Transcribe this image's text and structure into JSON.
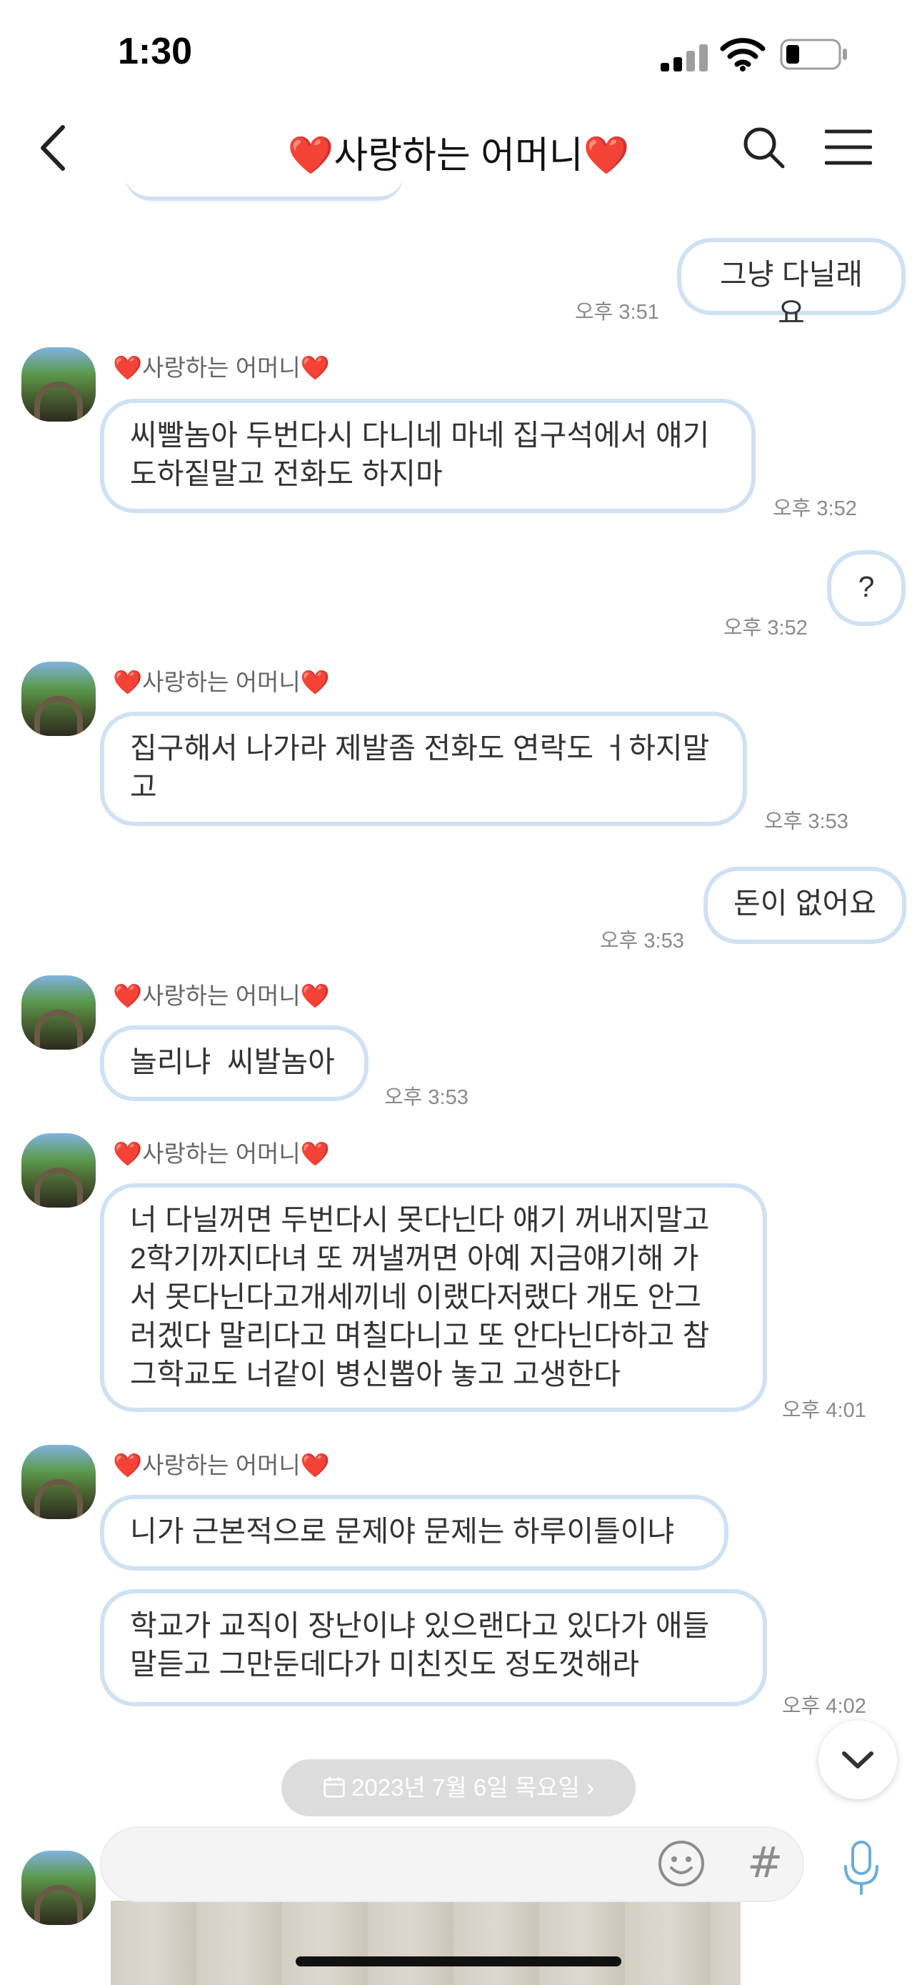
{
  "status": {
    "time": "1:30"
  },
  "header": {
    "title": "❤️사랑하는 어머니❤️"
  },
  "messages": [
    {
      "side": "out",
      "text": "그냥 다닐래요",
      "time": "오후 3:51"
    },
    {
      "side": "in",
      "sender": "❤️사랑하는 어머니❤️",
      "lines": [
        "씨빨놈아 두번다시 다니네 마네 집구석에서 얘기",
        "도하짙말고 전화도 하지마"
      ],
      "time": "오후 3:52"
    },
    {
      "side": "out",
      "text": "?",
      "time": "오후 3:52"
    },
    {
      "side": "in",
      "sender": "❤️사랑하는 어머니❤️",
      "lines": [
        "집구해서 나가라 제발좀 전화도 연락도 ㅓ하지말",
        "고"
      ],
      "time": "오후 3:53"
    },
    {
      "side": "out",
      "text": "돈이 없어요",
      "time": "오후 3:53"
    },
    {
      "side": "in",
      "sender": "❤️사랑하는 어머니❤️",
      "lines": [
        "놀리냐  씨발놈아"
      ],
      "time": "오후 3:53"
    },
    {
      "side": "in",
      "sender": "❤️사랑하는 어머니❤️",
      "lines": [
        "너 다닐꺼면 두번다시 못다닌다 얘기 꺼내지말고",
        "2학기까지다녀 또 꺼낼꺼면 아예 지금얘기해 가",
        "서 못다닌다고개세끼네 이랬다저랬다 개도 안그",
        "러겠다 말리다고 며칠다니고 또 안다닌다하고 참",
        "그학교도 너같이 병신뽑아 놓고 고생한다"
      ],
      "time": "오후 4:01"
    },
    {
      "side": "in",
      "sender": "❤️사랑하는 어머니❤️",
      "lines": [
        "니가 근본적으로 문제야 문제는 하루이틀이냐"
      ],
      "time": ""
    },
    {
      "side": "in",
      "lines": [
        "학교가 교직이 장난이냐 있으랜다고 있다가 애들",
        "말듣고 그만둔데다가 미친짓도 정도껏해라"
      ],
      "time": "오후 4:02"
    }
  ],
  "date_divider": {
    "label": "2023년 7월 6일 목요일 ›"
  },
  "input": {
    "placeholder": ""
  },
  "icons": {
    "back": "chevron-left-icon",
    "search": "search-icon",
    "menu": "hamburger-icon",
    "emoji": "emoji-icon",
    "hash": "#",
    "mic": "microphone-icon",
    "scroll": "chevron-down-icon"
  },
  "colors": {
    "bubble_border": "#cfe1f3",
    "heart": "#e0241b"
  }
}
